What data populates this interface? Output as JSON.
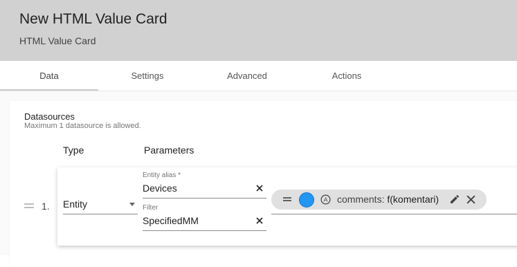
{
  "header": {
    "title": "New HTML Value Card",
    "subtitle": "HTML Value Card"
  },
  "tabs": [
    {
      "label": "Data",
      "active": true
    },
    {
      "label": "Settings",
      "active": false
    },
    {
      "label": "Advanced",
      "active": false
    },
    {
      "label": "Actions",
      "active": false
    }
  ],
  "datasources": {
    "title": "Datasources",
    "hint": "Maximum 1 datasource is allowed.",
    "columns": {
      "type": "Type",
      "parameters": "Parameters"
    },
    "row": {
      "index": "1.",
      "type": "Entity",
      "entity_alias_label": "Entity alias *",
      "entity_alias_value": "Devices",
      "filter_label": "Filter",
      "filter_value": "SpecifiedMM",
      "key_chip": {
        "color": "#2196f3",
        "prefix": "comments: ",
        "func": "f(komentari)"
      }
    }
  }
}
